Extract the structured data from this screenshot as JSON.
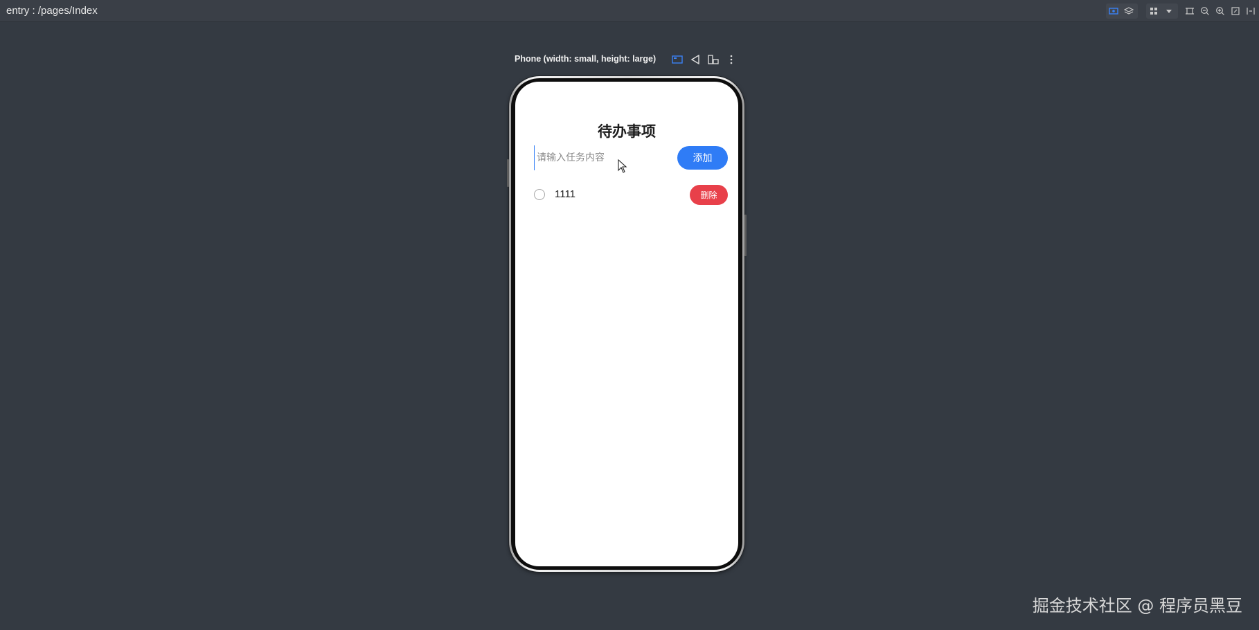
{
  "toolbar": {
    "route": "entry : /pages/Index"
  },
  "device": {
    "label": "Phone (width: small, height: large)"
  },
  "app": {
    "title": "待办事项",
    "input": {
      "placeholder": "请输入任务内容",
      "value": ""
    },
    "add_label": "添加",
    "tasks": [
      {
        "text": "1111",
        "done": false,
        "delete_label": "删除"
      }
    ]
  },
  "watermark": "掘金技术社区 @ 程序员黑豆",
  "colors": {
    "background": "#343a42",
    "primary_button": "#2f7cf6",
    "delete_button": "#e8404a"
  }
}
